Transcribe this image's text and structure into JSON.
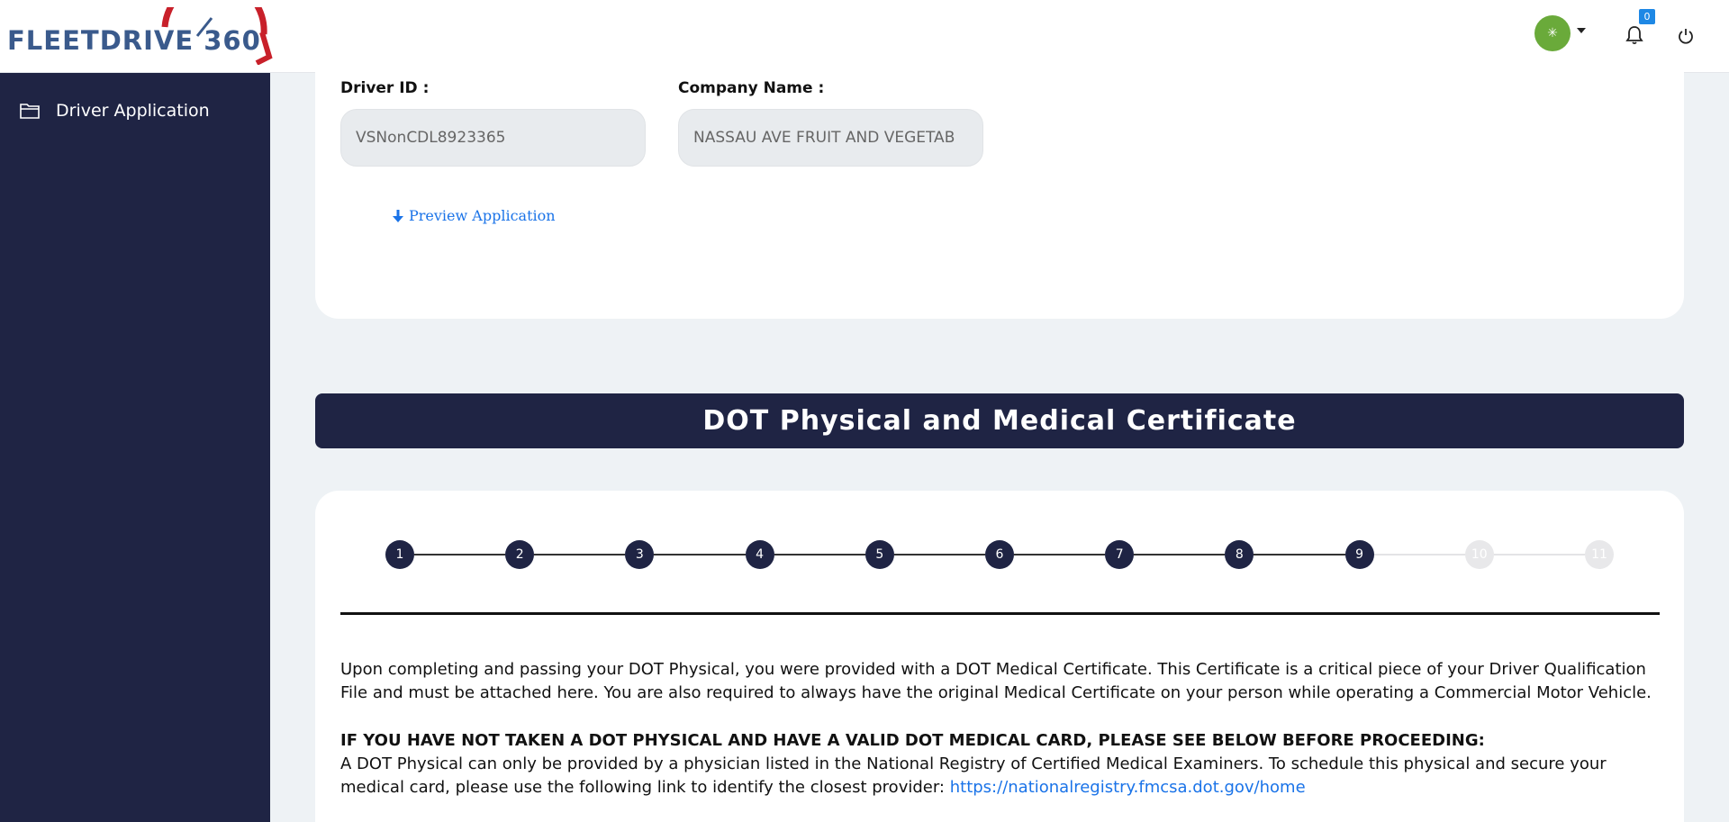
{
  "brand": {
    "logo_text": "FLEETDRIVE 360"
  },
  "header": {
    "avatar_initial": "✳",
    "notification_count": "0"
  },
  "sidebar": {
    "items": [
      {
        "label": "Driver Application"
      }
    ]
  },
  "form": {
    "driver_id_label": "Driver ID :",
    "driver_id_value": "VSNonCDL8923365",
    "company_label": "Company Name :",
    "company_value": "NASSAU AVE FRUIT AND VEGETAB",
    "preview_label": "Preview Application"
  },
  "section": {
    "title": "DOT Physical and Medical Certificate"
  },
  "stepper": {
    "steps": [
      "1",
      "2",
      "3",
      "4",
      "5",
      "6",
      "7",
      "8",
      "9",
      "10",
      "11"
    ],
    "current": 9
  },
  "content": {
    "paragraph1": "Upon completing and passing your DOT Physical, you were provided with a DOT Medical Certificate. This Certificate is a critical piece of your Driver Qualification File and must be attached here. You are also required to always have the original Medical Certificate on your person while operating a Commercial Motor Vehicle.",
    "warning_heading": "IF YOU HAVE NOT TAKEN A DOT PHYSICAL AND HAVE A VALID DOT MEDICAL CARD, PLEASE SEE BELOW BEFORE PROCEEDING:",
    "paragraph2": "A DOT Physical can only be provided by a physician listed in the National Registry of Certified Medical Examiners. To schedule this physical and secure your medical card, please use the following link to identify the closest provider:",
    "registry_link": "https://nationalregistry.fmcsa.dot.gov/home"
  },
  "colors": {
    "navy": "#1f2444",
    "link": "#1a73e8",
    "avatar": "#6aaa3a",
    "badge": "#1e88e5"
  }
}
